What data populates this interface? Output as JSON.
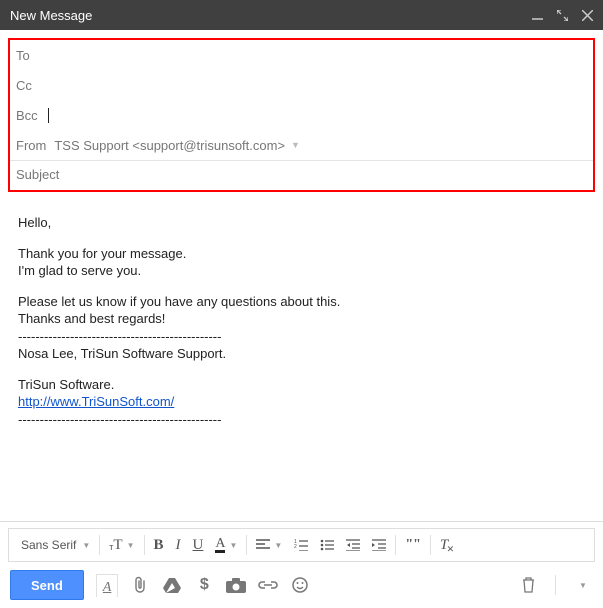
{
  "titlebar": {
    "title": "New Message"
  },
  "fields": {
    "to_label": "To",
    "cc_label": "Cc",
    "bcc_label": "Bcc",
    "from_label": "From",
    "from_value": "TSS Support <support@trisunsoft.com>",
    "subject_label": "Subject"
  },
  "body": {
    "l1": "Hello,",
    "l2": "Thank you for your message.",
    "l3": "I'm glad to serve you.",
    "l4": "Please let us know if you have any questions about this.",
    "l5": "Thanks and best regards!",
    "l6": "-----------------------------------------------",
    "l7": "Nosa Lee, TriSun Software Support.",
    "l8": "TriSun Software.",
    "link": "http://www.TriSunSoft.com/",
    "l9": "-----------------------------------------------"
  },
  "toolbar": {
    "font_family": "Sans Serif",
    "size_label": "T",
    "bold": "B",
    "italic": "I",
    "underline": "U",
    "textcolor": "A",
    "quote": "\"\""
  },
  "actions": {
    "send": "Send",
    "currency": "$"
  }
}
